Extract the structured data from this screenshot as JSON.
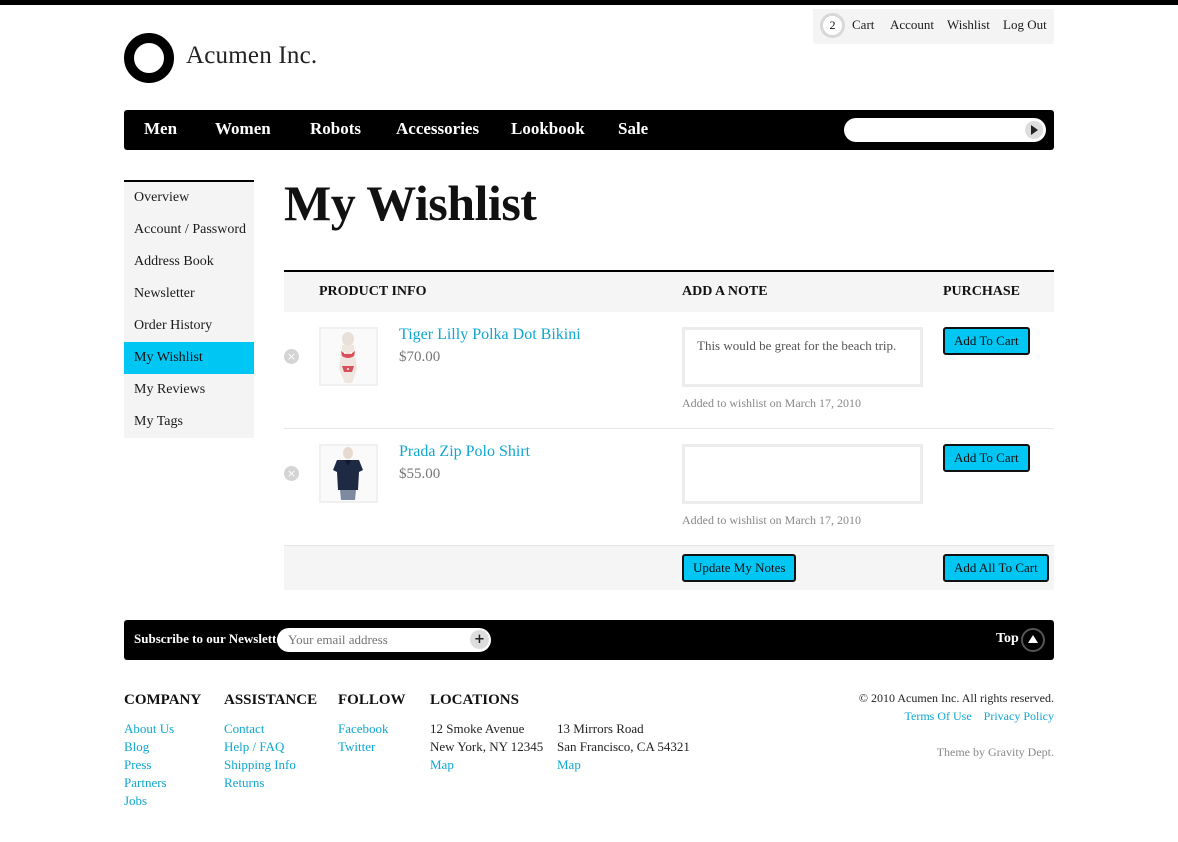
{
  "header": {
    "brand": "Acumen Inc.",
    "cart_count": "2",
    "links": [
      "Cart",
      "Account",
      "Wishlist",
      "Log Out"
    ]
  },
  "nav": {
    "items": [
      "Men",
      "Women",
      "Robots",
      "Accessories",
      "Lookbook",
      "Sale"
    ],
    "search_placeholder": ""
  },
  "sidebar": {
    "items": [
      {
        "label": "Overview"
      },
      {
        "label": "Account / Password"
      },
      {
        "label": "Address Book"
      },
      {
        "label": "Newsletter"
      },
      {
        "label": "Order History"
      },
      {
        "label": "My Wishlist",
        "active": true
      },
      {
        "label": "My Reviews"
      },
      {
        "label": "My Tags"
      }
    ]
  },
  "page": {
    "title": "My Wishlist",
    "columns": {
      "product": "PRODUCT INFO",
      "note": "ADD A NOTE",
      "purchase": "PURCHASE"
    },
    "items": [
      {
        "name": "Tiger Lilly Polka Dot Bikini",
        "price": "$70.00",
        "note": "This would be great for the beach trip.",
        "added": "Added to wishlist on March 17, 2010",
        "button": "Add To Cart",
        "thumb": "bikini"
      },
      {
        "name": "Prada Zip Polo Shirt",
        "price": "$55.00",
        "note": "",
        "added": "Added to wishlist on March 17, 2010",
        "button": "Add To Cart",
        "thumb": "polo"
      }
    ],
    "update_button": "Update My Notes",
    "add_all_button": "Add All To Cart"
  },
  "newsletter": {
    "label": "Subscribe to our Newsletter",
    "placeholder": "Your email address",
    "top_label": "Top"
  },
  "footer": {
    "company": {
      "heading": "COMPANY",
      "links": [
        "About Us",
        "Blog",
        "Press",
        "Partners",
        "Jobs"
      ]
    },
    "assistance": {
      "heading": "ASSISTANCE",
      "links": [
        "Contact",
        "Help / FAQ",
        "Shipping Info",
        "Returns"
      ]
    },
    "follow": {
      "heading": "FOLLOW",
      "links": [
        "Facebook",
        "Twitter"
      ]
    },
    "locations": {
      "heading": "LOCATIONS",
      "addresses": [
        {
          "street": "12 Smoke Avenue",
          "city": "New York, NY 12345",
          "map": "Map"
        },
        {
          "street": "13 Mirrors Road",
          "city": "San Francisco, CA 54321",
          "map": "Map"
        }
      ]
    },
    "copyright": "© 2010 Acumen Inc. All rights reserved.",
    "terms": "Terms Of Use",
    "privacy": "Privacy Policy",
    "theme": "Theme by Gravity Dept."
  },
  "colors": {
    "accent": "#00c6f4",
    "link": "#0fa6d1",
    "nav_bg": "#000000"
  }
}
